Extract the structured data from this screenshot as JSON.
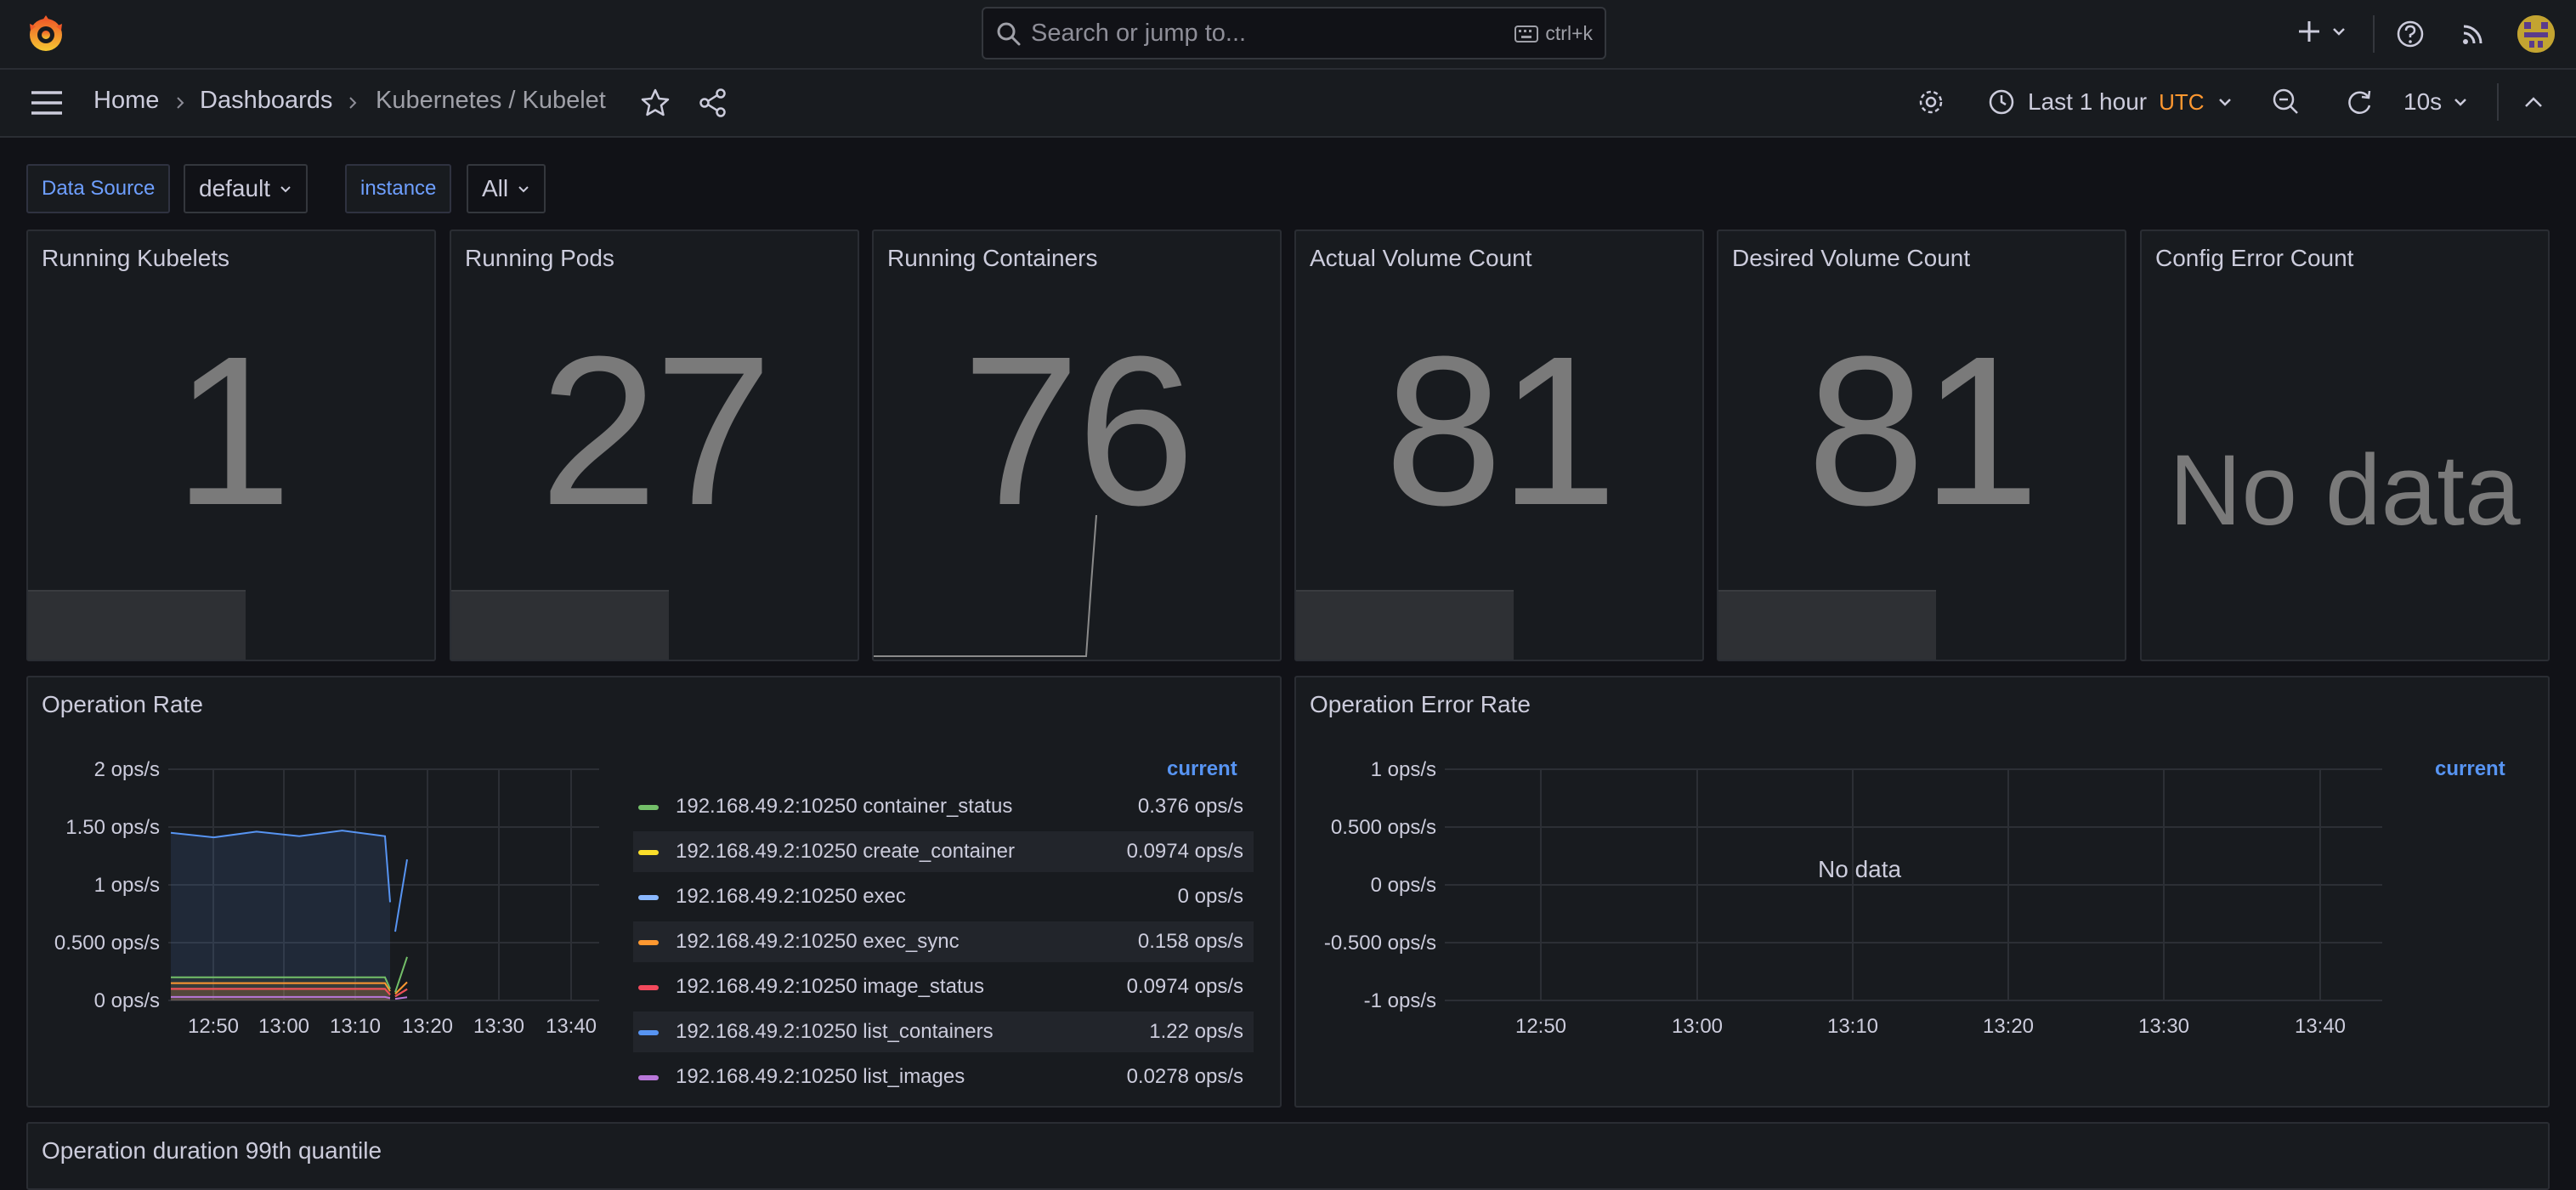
{
  "search": {
    "placeholder": "Search or jump to...",
    "shortcut": "ctrl+k"
  },
  "breadcrumb": {
    "home": "Home",
    "dashboards": "Dashboards",
    "current": "Kubernetes / Kubelet"
  },
  "timepicker": {
    "range": "Last 1 hour",
    "timezone": "UTC",
    "refresh": "10s"
  },
  "variables": [
    {
      "label": "Data Source",
      "value": "default"
    },
    {
      "label": "instance",
      "value": "All"
    }
  ],
  "stats": [
    {
      "title": "Running Kubelets",
      "value": "1"
    },
    {
      "title": "Running Pods",
      "value": "27"
    },
    {
      "title": "Running Containers",
      "value": "76"
    },
    {
      "title": "Actual Volume Count",
      "value": "81"
    },
    {
      "title": "Desired Volume Count",
      "value": "81"
    },
    {
      "title": "Config Error Count",
      "value": "No data"
    }
  ],
  "operation_rate": {
    "title": "Operation Rate",
    "legend_header": "current",
    "legend": [
      {
        "name": "192.168.49.2:10250 container_status",
        "value": "0.376 ops/s",
        "color": "#73bf69"
      },
      {
        "name": "192.168.49.2:10250 create_container",
        "value": "0.0974 ops/s",
        "color": "#fade2a"
      },
      {
        "name": "192.168.49.2:10250 exec",
        "value": "0 ops/s",
        "color": "#8ab8ff"
      },
      {
        "name": "192.168.49.2:10250 exec_sync",
        "value": "0.158 ops/s",
        "color": "#ff9830"
      },
      {
        "name": "192.168.49.2:10250 image_status",
        "value": "0.0974 ops/s",
        "color": "#f2495c"
      },
      {
        "name": "192.168.49.2:10250 list_containers",
        "value": "1.22 ops/s",
        "color": "#5794f2"
      },
      {
        "name": "192.168.49.2:10250 list_images",
        "value": "0.0278 ops/s",
        "color": "#b877d9"
      }
    ]
  },
  "operation_error_rate": {
    "title": "Operation Error Rate",
    "legend_header": "current",
    "no_data": "No data"
  },
  "bottom_panel": {
    "title": "Operation duration 99th quantile"
  },
  "chart_data": [
    {
      "type": "line",
      "title": "Operation Rate",
      "x": [
        "12:50",
        "13:00",
        "13:10",
        "13:20",
        "13:30",
        "13:40"
      ],
      "ylim": [
        0,
        2
      ],
      "yticks": [
        "0 ops/s",
        "0.500 ops/s",
        "1 ops/s",
        "1.50 ops/s",
        "2 ops/s"
      ],
      "grid": true,
      "legend_placement": "right",
      "series": [
        {
          "name": "192.168.49.2:10250 list_containers",
          "values": [
            1.45,
            1.44,
            1.46,
            1.45,
            1.47,
            1.45,
            0.85,
            1.22
          ]
        },
        {
          "name": "192.168.49.2:10250 container_status",
          "values": [
            0.2,
            0.2,
            0.2,
            0.2,
            0.2,
            0.2,
            0.1,
            0.376
          ]
        },
        {
          "name": "192.168.49.2:10250 exec_sync",
          "values": [
            0.15,
            0.15,
            0.15,
            0.15,
            0.15,
            0.15,
            0.08,
            0.158
          ]
        },
        {
          "name": "192.168.49.2:10250 create_container",
          "values": [
            0.1,
            0.1,
            0.1,
            0.1,
            0.1,
            0.1,
            0.05,
            0.0974
          ]
        },
        {
          "name": "192.168.49.2:10250 image_status",
          "values": [
            0.1,
            0.1,
            0.1,
            0.1,
            0.1,
            0.1,
            0.05,
            0.0974
          ]
        },
        {
          "name": "192.168.49.2:10250 list_images",
          "values": [
            0.03,
            0.03,
            0.03,
            0.03,
            0.03,
            0.03,
            0.02,
            0.0278
          ]
        }
      ]
    },
    {
      "type": "line",
      "title": "Operation Error Rate",
      "x": [
        "12:50",
        "13:00",
        "13:10",
        "13:20",
        "13:30",
        "13:40"
      ],
      "ylim": [
        -1,
        1
      ],
      "yticks": [
        "-1 ops/s",
        "-0.500 ops/s",
        "0 ops/s",
        "0.500 ops/s",
        "1 ops/s"
      ],
      "grid": true,
      "series": []
    }
  ]
}
